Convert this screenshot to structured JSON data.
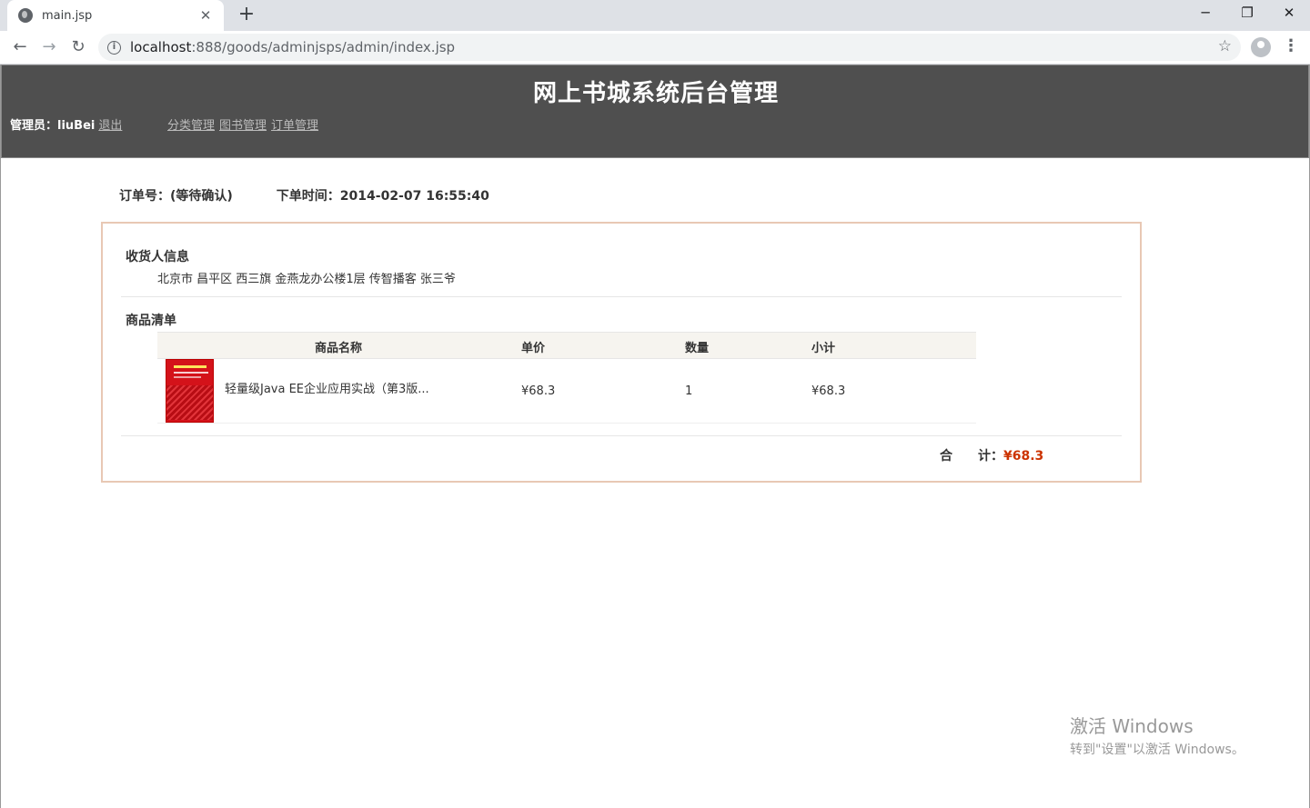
{
  "browser": {
    "tab_title": "main.jsp",
    "tab_close": "✕",
    "new_tab": "+",
    "url_host": "localhost",
    "url_path": ":888/goods/adminjsps/admin/index.jsp",
    "window_controls": {
      "minimize": "─",
      "restore": "❐",
      "close": "✕"
    },
    "nav": {
      "back": "←",
      "forward": "→",
      "reload": "↻"
    },
    "star": "☆",
    "menu": "⋮"
  },
  "header": {
    "title": "网上书城系统后台管理",
    "admin_label": "管理员：liuBei",
    "logout": "退出",
    "nav": [
      "分类管理",
      "图书管理",
      "订单管理"
    ]
  },
  "order": {
    "number_label": "订单号：(等待确认)",
    "time_label": "下单时间：2014-02-07 16:55:40",
    "receiver_title": "收货人信息",
    "receiver_info": "北京市 昌平区 西三旗 金燕龙办公楼1层 传智播客 张三爷",
    "items_title": "商品清单",
    "columns": [
      "商品名称",
      "单价",
      "数量",
      "小计"
    ],
    "items": [
      {
        "name": "轻量级Java EE企业应用实战（第3版...",
        "price": "¥68.3",
        "qty": "1",
        "subtotal": "¥68.3"
      }
    ],
    "total_label": "合　　计：",
    "total_value": "¥68.3"
  },
  "watermark": {
    "line1": "激活 Windows",
    "line2": "转到\"设置\"以激活 Windows。"
  }
}
